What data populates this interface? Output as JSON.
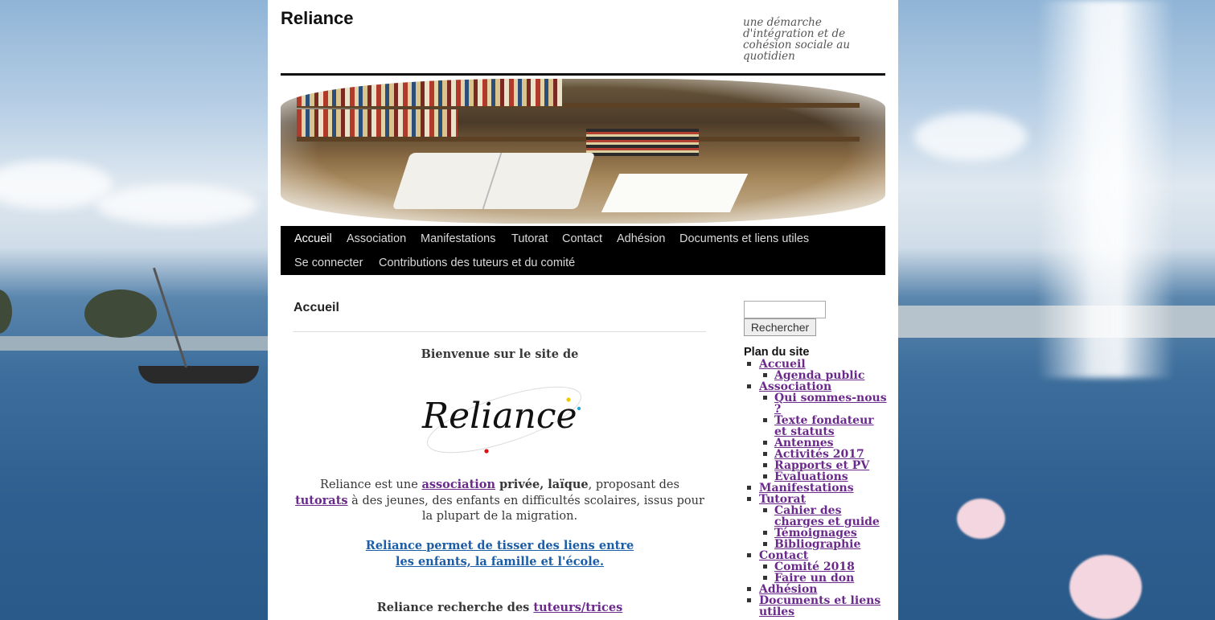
{
  "site": {
    "title": "Reliance",
    "description": "une démarche d'intégration et de cohésion sociale au quotidien"
  },
  "nav": {
    "items": [
      {
        "label": "Accueil"
      },
      {
        "label": "Association"
      },
      {
        "label": "Manifestations"
      },
      {
        "label": "Tutorat"
      },
      {
        "label": "Contact"
      },
      {
        "label": "Adhésion"
      },
      {
        "label": "Documents et liens utiles"
      },
      {
        "label": "Se connecter"
      },
      {
        "label": "Contributions des tuteurs et du comité"
      }
    ]
  },
  "content": {
    "title": "Accueil",
    "welcome": "Bienvenue sur le site de",
    "logo_text": "Reliance",
    "intro": {
      "pre": "Reliance est une ",
      "link1": "association",
      "bold": " privée, laïque",
      "mid": ", proposant des ",
      "link2": "tutorats",
      "post": " à des jeunes, des enfants en difficultés scolaires, issus pour la plupart de la migration."
    },
    "tagline_line1": "Reliance permet de tisser des liens entre",
    "tagline_line2": "les enfants, la famille et l'école.",
    "recruit_text": "Reliance recherche des ",
    "recruit_link": "tuteurs/trices"
  },
  "sidebar": {
    "search_placeholder": "",
    "search_button": "Rechercher",
    "sitemap_title": "Plan du site",
    "sitemap": {
      "accueil": "Accueil",
      "agenda": "Agenda public",
      "association": "Association",
      "qui_line1": "Qui sommes-nous",
      "qui_line2": "?",
      "texte_line1": "Texte fondateur",
      "texte_line2": "et statuts",
      "antennes": "Antennes",
      "activites": "Activités 2017",
      "rapports": "Rapports et PV",
      "evaluations": "Evaluations",
      "manifestations": "Manifestations",
      "tutorat": "Tutorat",
      "cahier_line1": "Cahier des",
      "cahier_line2": "charges et guide",
      "temoignages": "Témoignages",
      "bibliographie": "Bibliographie",
      "contact": "Contact",
      "comite": "Comité 2018",
      "don": "Faire un don",
      "adhesion": "Adhésion",
      "documents_line1": "Documents et liens",
      "documents_line2": "utiles"
    }
  }
}
